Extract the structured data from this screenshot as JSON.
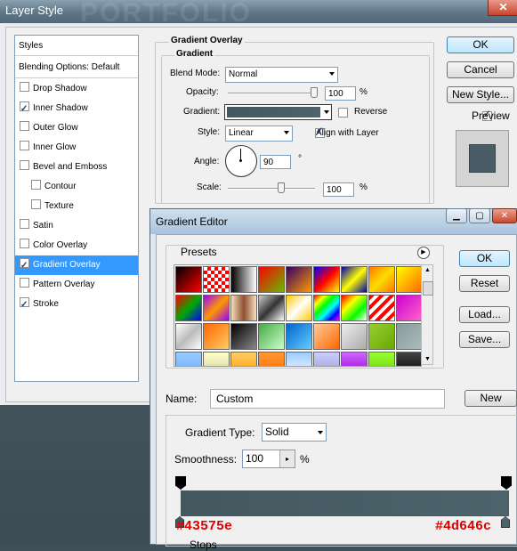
{
  "layer_style": {
    "title": "Layer Style",
    "watermark": "PORTFOLIO",
    "close_glyph": "✕",
    "list": {
      "styles_header": "Styles",
      "blending_header": "Blending Options: Default",
      "items": [
        {
          "label": "Drop Shadow",
          "checked": false,
          "indent": false
        },
        {
          "label": "Inner Shadow",
          "checked": true,
          "indent": false
        },
        {
          "label": "Outer Glow",
          "checked": false,
          "indent": false
        },
        {
          "label": "Inner Glow",
          "checked": false,
          "indent": false
        },
        {
          "label": "Bevel and Emboss",
          "checked": false,
          "indent": false
        },
        {
          "label": "Contour",
          "checked": false,
          "indent": true
        },
        {
          "label": "Texture",
          "checked": false,
          "indent": true
        },
        {
          "label": "Satin",
          "checked": false,
          "indent": false
        },
        {
          "label": "Color Overlay",
          "checked": false,
          "indent": false
        },
        {
          "label": "Gradient Overlay",
          "checked": true,
          "indent": false,
          "selected": true
        },
        {
          "label": "Pattern Overlay",
          "checked": false,
          "indent": false
        },
        {
          "label": "Stroke",
          "checked": true,
          "indent": false
        }
      ]
    },
    "panel": {
      "title": "Gradient Overlay",
      "subtitle": "Gradient",
      "blend_mode_label": "Blend Mode:",
      "blend_mode_value": "Normal",
      "opacity_label": "Opacity:",
      "opacity_value": "100",
      "opacity_unit": "%",
      "gradient_label": "Gradient:",
      "reverse_label": "Reverse",
      "style_label": "Style:",
      "style_value": "Linear",
      "align_label": "Align with Layer",
      "angle_label": "Angle:",
      "angle_value": "90",
      "angle_unit": "°",
      "scale_label": "Scale:",
      "scale_value": "100",
      "scale_unit": "%"
    },
    "buttons": {
      "ok": "OK",
      "cancel": "Cancel",
      "new_style": "New Style...",
      "preview": "Preview"
    },
    "preview_color": "#4a5d66"
  },
  "gradient_editor": {
    "title": "Gradient Editor",
    "presets_label": "Presets",
    "buttons": {
      "ok": "OK",
      "reset": "Reset",
      "load": "Load...",
      "save": "Save...",
      "new": "New"
    },
    "name_label": "Name:",
    "name_value": "Custom",
    "gradient_type_label": "Gradient Type:",
    "gradient_type_value": "Solid",
    "smoothness_label": "Smoothness:",
    "smoothness_value": "100",
    "smoothness_unit": "%",
    "stops_label": "Stops",
    "color_left": "#43575e",
    "color_right": "#4d646c",
    "swatches": [
      [
        "linear-gradient(135deg,#000,#f00)",
        "repeating-conic-gradient(#f00 0 25%,#fff 0 50%)",
        "linear-gradient(90deg,#000,#fff)",
        "linear-gradient(135deg,#f00,#6b0)",
        "linear-gradient(135deg,#306,#f90)",
        "linear-gradient(135deg,#00f,#f00,#ff0)",
        "linear-gradient(135deg,#00a,#ff0,#00a)",
        "linear-gradient(135deg,#f70,#fd0,#f70)",
        "linear-gradient(135deg,#ff0,#f60)"
      ],
      [
        "linear-gradient(135deg,#f00,#0a0,#00f)",
        "linear-gradient(135deg,#90f,#f90,#90f)",
        "linear-gradient(90deg,#f4e0c0,#905030,#f4e0c0)",
        "linear-gradient(135deg,#ccc,#333,#fff)",
        "linear-gradient(135deg,#fc0,#fff,#fc0)",
        "linear-gradient(135deg,#f00,#ff0,#0f0,#0ff,#00f,#f0f)",
        "linear-gradient(135deg,#f00,#ff0,#0f0,#fff)",
        "repeating-linear-gradient(135deg,#f00 0 4px,#fff 4px 8px)",
        "linear-gradient(135deg,#c0c,#f6c)"
      ],
      [
        "linear-gradient(135deg,#fff,#bbb,#fff)",
        "linear-gradient(135deg,#f60,#fc6)",
        "linear-gradient(135deg,#000,#888)",
        "linear-gradient(135deg,#4a4,#cfc)",
        "linear-gradient(135deg,#06c,#6cf)",
        "linear-gradient(135deg,#fc9,#f60)",
        "linear-gradient(135deg,#eee,#aaa)",
        "linear-gradient(135deg,#9c3,#6a0)",
        "linear-gradient(135deg,#899,#abb)"
      ],
      [
        "linear-gradient(180deg,#9cf,#6af)",
        "linear-gradient(180deg,#ffc,#cc9)",
        "linear-gradient(180deg,#fc6,#f90)",
        "linear-gradient(180deg,#f93,#f60)",
        "linear-gradient(180deg,#9cf,#fff)",
        "linear-gradient(180deg,#ccf,#99c)",
        "linear-gradient(180deg,#c6f,#90c)",
        "linear-gradient(180deg,#9f3,#6c0)",
        "linear-gradient(180deg,#444,#000)"
      ]
    ]
  }
}
